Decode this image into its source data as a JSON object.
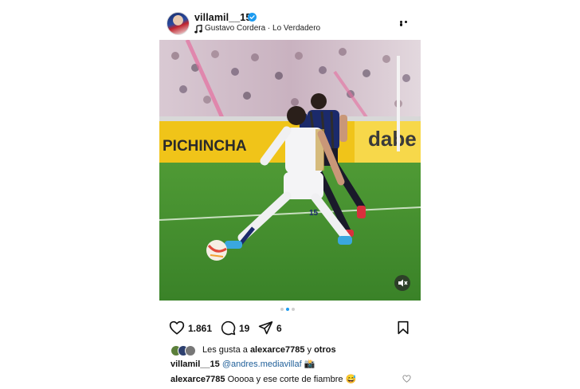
{
  "header": {
    "username": "villamil__15",
    "song": "Gustavo Cordera · Lo Verdadero"
  },
  "photo": {
    "banner_text": "PICHINCHA",
    "banner_text_right": "dabe",
    "player_number": "15",
    "carousel_count": 3,
    "carousel_active": 2
  },
  "actions": {
    "likes_count": "1.861",
    "comments_count": "19",
    "shares_count": "6"
  },
  "likes_line": {
    "prefix": "Les gusta a",
    "user": "alexarce7785",
    "connector": "y",
    "suffix": "otros"
  },
  "caption": {
    "user": "villamil__15",
    "mention": "@andres.mediavillaf",
    "emoji": "📸"
  },
  "comment": {
    "user": "alexarce7785",
    "text": "Ooooa y ese corte de fiambre",
    "emoji": "😅"
  },
  "colors": {
    "verified": "#1d9bf0",
    "mention": "#1f5f99",
    "pitch": "#3f8a2c",
    "ad_board": "#f0c419"
  }
}
